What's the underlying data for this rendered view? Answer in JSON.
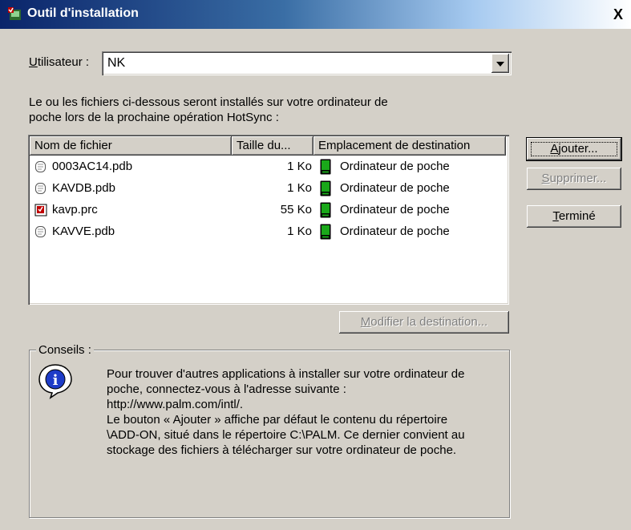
{
  "window": {
    "title": "Outil d'installation",
    "close_label": "X"
  },
  "user": {
    "label_prefix": "U",
    "label_rest": "tilisateur :",
    "value": "NK"
  },
  "intro": {
    "line1": "Le ou les fichiers ci-dessous seront installés sur votre ordinateur de",
    "line2": "poche lors de la prochaine opération HotSync :"
  },
  "table": {
    "headers": [
      "Nom de fichier",
      "Taille du...",
      "Emplacement de destination"
    ],
    "rows": [
      {
        "name": "0003AC14.pdb",
        "size": "1 Ko",
        "destination": "Ordinateur de poche",
        "icon": "pdb-file-icon"
      },
      {
        "name": "KAVDB.pdb",
        "size": "1 Ko",
        "destination": "Ordinateur de poche",
        "icon": "pdb-file-icon"
      },
      {
        "name": "kavp.prc",
        "size": "55 Ko",
        "destination": "Ordinateur de poche",
        "icon": "prc-file-icon"
      },
      {
        "name": "KAVVE.pdb",
        "size": "1 Ko",
        "destination": "Ordinateur de poche",
        "icon": "pdb-file-icon"
      }
    ]
  },
  "buttons": {
    "add_u": "A",
    "add_rest": "jouter...",
    "remove_u": "S",
    "remove_rest": "upprimer...",
    "done_u": "T",
    "done_rest": "erminé",
    "modify_u": "M",
    "modify_rest": "odifier la destination..."
  },
  "tips": {
    "label": "Conseils :",
    "lines": [
      "Pour trouver d'autres applications à installer sur votre ordinateur de",
      "poche, connectez-vous à l'adresse suivante :",
      "http://www.palm.com/intl/.",
      "Le bouton « Ajouter » affiche par défaut le contenu du répertoire",
      "\\ADD-ON, situé dans le répertoire C:\\PALM. Ce dernier convient au",
      "stockage des fichiers à télécharger sur votre ordinateur de poche."
    ]
  },
  "colors": {
    "titlebar_start": "#0a246a",
    "titlebar_end": "#ffffff",
    "face": "#d4d0c8",
    "device_green": "#1aa81a"
  }
}
